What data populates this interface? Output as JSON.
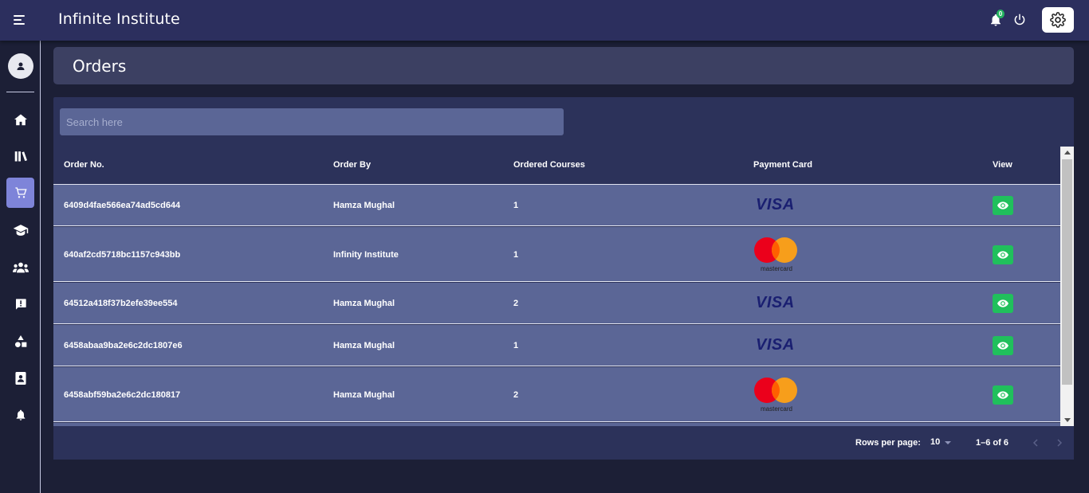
{
  "app": {
    "title": "Infinite Institute",
    "notification_count": "0"
  },
  "page": {
    "title": "Orders"
  },
  "search": {
    "placeholder": "Search here"
  },
  "table": {
    "columns": [
      "Order No.",
      "Order By",
      "Ordered Courses",
      "Payment Card",
      "View"
    ],
    "rows": [
      {
        "order_no": "6409d4fae566ea74ad5cd644",
        "order_by": "Hamza Mughal",
        "courses": "1",
        "card": "visa"
      },
      {
        "order_no": "640af2cd5718bc1157c943bb",
        "order_by": "Infinity Institute",
        "courses": "1",
        "card": "mastercard"
      },
      {
        "order_no": "64512a418f37b2efe39ee554",
        "order_by": "Hamza Mughal",
        "courses": "2",
        "card": "visa"
      },
      {
        "order_no": "6458abaa9ba2e6c2dc1807e6",
        "order_by": "Hamza Mughal",
        "courses": "1",
        "card": "visa"
      },
      {
        "order_no": "6458abf59ba2e6c2dc180817",
        "order_by": "Hamza Mughal",
        "courses": "2",
        "card": "mastercard"
      }
    ]
  },
  "cards": {
    "visa_text": "VISA",
    "mastercard_text": "mastercard"
  },
  "pagination": {
    "rows_per_page_label": "Rows per page:",
    "rows_per_page": "10",
    "range": "1–6 of 6"
  },
  "colors": {
    "accent": "#7e84d9",
    "view_button": "#20c05c",
    "row_bg": "#5b6696"
  },
  "sidebar": {
    "items": [
      "home-icon",
      "library-icon",
      "cart-icon",
      "graduation-cap-icon",
      "users-icon",
      "feedback-icon",
      "shapes-icon",
      "contacts-icon",
      "bell-icon"
    ],
    "active": "cart-icon"
  }
}
